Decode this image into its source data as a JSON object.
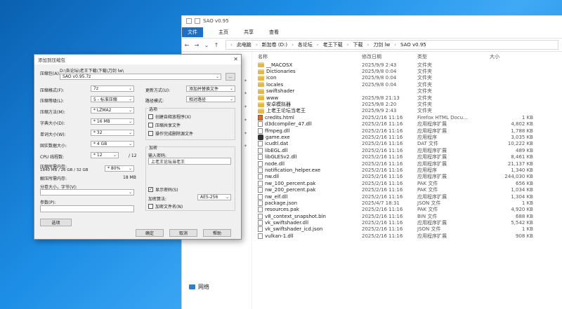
{
  "explorer": {
    "title": "SAO v0.95",
    "ribbon": [
      "文件",
      "主页",
      "共享",
      "查看"
    ],
    "address": [
      "此电脑",
      "新加卷 (D:)",
      "各论坛",
      "老王下载",
      "下载",
      "刀剑 lw",
      "SAO v0.95"
    ],
    "columns": {
      "name": "名称",
      "date": "修改日期",
      "type": "类型",
      "size": "大小"
    },
    "files": [
      {
        "name": "__MACOSX",
        "date": "2025/9/9 2:43",
        "type": "文件夹",
        "size": "",
        "icon": "folder"
      },
      {
        "name": "Dictionaries",
        "date": "2025/9/8 0:04",
        "type": "文件夹",
        "size": "",
        "icon": "folder"
      },
      {
        "name": "icon",
        "date": "2025/9/8 0:04",
        "type": "文件夹",
        "size": "",
        "icon": "folder"
      },
      {
        "name": "locales",
        "date": "2025/9/8 0:04",
        "type": "文件夹",
        "size": "",
        "icon": "folder"
      },
      {
        "name": "swiftshader",
        "date": "",
        "type": "文件夹",
        "size": "",
        "icon": "folder"
      },
      {
        "name": "www",
        "date": "2025/9/8 21:13",
        "type": "文件夹",
        "size": "",
        "icon": "folder"
      },
      {
        "name": "安卓模拟器",
        "date": "2025/9/8 2:20",
        "type": "文件夹",
        "size": "",
        "icon": "folder"
      },
      {
        "name": "上老王论坛当老王",
        "date": "2025/9/9 2:43",
        "type": "文件夹",
        "size": "",
        "icon": "folder"
      },
      {
        "name": "credits.html",
        "date": "2025/2/16 11:16",
        "type": "Firefox HTML Docu...",
        "size": "1 KB",
        "icon": "html"
      },
      {
        "name": "d3dcompiler_47.dll",
        "date": "2025/2/16 11:16",
        "type": "应用程序扩展",
        "size": "4,802 KB",
        "icon": "file"
      },
      {
        "name": "ffmpeg.dll",
        "date": "2025/2/16 11:16",
        "type": "应用程序扩展",
        "size": "1,788 KB",
        "icon": "file"
      },
      {
        "name": "game.exe",
        "date": "2025/2/16 11:16",
        "type": "应用程序",
        "size": "3,035 KB",
        "icon": "exe"
      },
      {
        "name": "icudtl.dat",
        "date": "2025/2/16 11:16",
        "type": "DAT 文件",
        "size": "10,222 KB",
        "icon": "file"
      },
      {
        "name": "libEGL.dll",
        "date": "2025/2/16 11:16",
        "type": "应用程序扩展",
        "size": "489 KB",
        "icon": "file"
      },
      {
        "name": "libGLESv2.dll",
        "date": "2025/2/16 11:16",
        "type": "应用程序扩展",
        "size": "8,461 KB",
        "icon": "file"
      },
      {
        "name": "node.dll",
        "date": "2025/2/16 11:16",
        "type": "应用程序扩展",
        "size": "21,137 KB",
        "icon": "file"
      },
      {
        "name": "notification_helper.exe",
        "date": "2025/2/16 11:16",
        "type": "应用程序",
        "size": "1,340 KB",
        "icon": "file"
      },
      {
        "name": "nw.dll",
        "date": "2025/2/16 11:16",
        "type": "应用程序扩展",
        "size": "244,030 KB",
        "icon": "file"
      },
      {
        "name": "nw_100_percent.pak",
        "date": "2025/2/16 11:16",
        "type": "PAK 文件",
        "size": "656 KB",
        "icon": "file"
      },
      {
        "name": "nw_200_percent.pak",
        "date": "2025/2/16 11:16",
        "type": "PAK 文件",
        "size": "1,034 KB",
        "icon": "file"
      },
      {
        "name": "nw_elf.dll",
        "date": "2025/2/16 11:16",
        "type": "应用程序扩展",
        "size": "1,304 KB",
        "icon": "file"
      },
      {
        "name": "package.json",
        "date": "2025/4/7 18:31",
        "type": "JSON 文件",
        "size": "1 KB",
        "icon": "file"
      },
      {
        "name": "resources.pak",
        "date": "2025/2/16 11:16",
        "type": "PAK 文件",
        "size": "4,920 KB",
        "icon": "file"
      },
      {
        "name": "v8_context_snapshot.bin",
        "date": "2025/2/16 11:16",
        "type": "BIN 文件",
        "size": "688 KB",
        "icon": "file"
      },
      {
        "name": "vk_swiftshader.dll",
        "date": "2025/2/16 11:16",
        "type": "应用程序扩展",
        "size": "5,542 KB",
        "icon": "file"
      },
      {
        "name": "vk_swiftshader_icd.json",
        "date": "2025/2/16 11:16",
        "type": "JSON 文件",
        "size": "1 KB",
        "icon": "file"
      },
      {
        "name": "vulkan-1.dll",
        "date": "2025/2/16 11:16",
        "type": "应用程序扩展",
        "size": "908 KB",
        "icon": "file"
      }
    ],
    "nav_network": "网络"
  },
  "dialog": {
    "title": "添加到压缩包",
    "archive_label": "压缩包(A):",
    "archive_path": "D:\\各论坛\\老王下载\\下载\\刀剑 lw\\",
    "archive_name": "SAO v0.95.7z",
    "browse": "...",
    "format_label": "压缩格式(F):",
    "format_value": "7z",
    "level_label": "压缩等级(L):",
    "level_value": "5 - 标准压缩",
    "method_label": "压缩方法(M):",
    "method_value": "* LZMA2",
    "dict_label": "字典大小(D):",
    "dict_value": "* 16 MB",
    "word_label": "单词大小(W):",
    "word_value": "* 32",
    "solid_label": "固实数据大小:",
    "solid_value": "* 4 GB",
    "cpu_label": "CPU 线程数:",
    "cpu_value": "* 12",
    "cpu_total": "/ 12",
    "mem_comp_label": "压缩所需内存:",
    "mem_comp_value": "1840 MB / 26 GB / 32 GB",
    "mem_percent": "* 80%",
    "mem_decomp_label": "解压所需内存:",
    "mem_decomp_value": "18 MB",
    "split_label": "分卷大小，字节(V):",
    "params_label": "参数(P):",
    "options_button": "选项",
    "update_label": "更新方式(U):",
    "update_value": "添加并替换文件",
    "pathmode_label": "路径模式:",
    "pathmode_value": "相对路径",
    "options_group": "选项",
    "opt_sfx": "创建自释放程序(X)",
    "opt_shared": "压缩共享文件",
    "opt_delete": "操作完成删除源文件",
    "encrypt_group": "加密",
    "password_label": "输入密码:",
    "password_value": "上老王论坛当老王",
    "show_password": "显示密码(S)",
    "enc_method_label": "加密算法:",
    "enc_method_value": "AES-256",
    "encrypt_names": "加密文件名(N)",
    "ok": "确定",
    "cancel": "取消",
    "help": "帮助"
  }
}
